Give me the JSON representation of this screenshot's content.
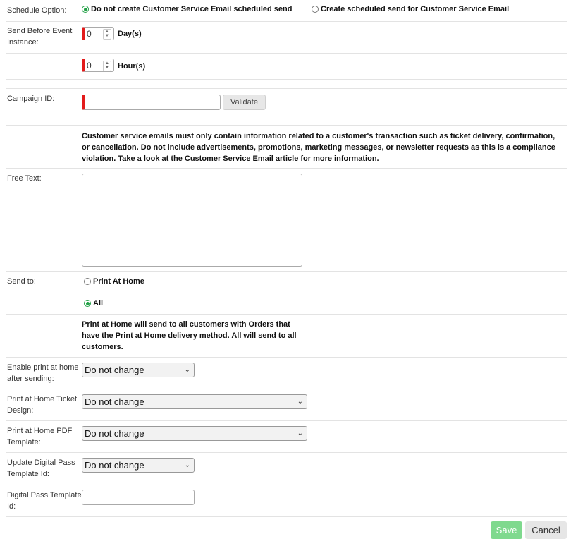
{
  "schedule": {
    "label": "Schedule Option:",
    "option_no": "Do not create Customer Service Email scheduled send",
    "option_yes": "Create scheduled send for Customer Service Email"
  },
  "send_before": {
    "label": "Send Before Event Instance:",
    "days_value": "0",
    "days_unit": "Day(s)",
    "hours_value": "0",
    "hours_unit": "Hour(s)"
  },
  "campaign": {
    "label": "Campaign ID:",
    "value": "",
    "validate_label": "Validate"
  },
  "notice": {
    "text_before": "Customer service emails must only contain information related to a customer's transaction such as ticket delivery, confirmation, or cancellation. Do not include advertisements, promotions, marketing messages, or newsletter requests as this is a compliance violation. Take a look at the ",
    "link_text": "Customer Service Email",
    "text_after": " article for more information."
  },
  "free_text": {
    "label": "Free Text:",
    "value": ""
  },
  "send_to": {
    "label": "Send to:",
    "option_print": "Print At Home",
    "option_all": "All",
    "description": "Print at Home will send to all customers with Orders that have the Print at Home delivery method. All will send to all customers."
  },
  "enable_print": {
    "label": "Enable print at home after sending:",
    "selected": "Do not change"
  },
  "ticket_design": {
    "label": "Print at Home Ticket Design:",
    "selected": "Do not change"
  },
  "pdf_template": {
    "label": "Print at Home PDF Template:",
    "selected": "Do not change"
  },
  "digital_pass": {
    "label": "Update Digital Pass Template Id:",
    "selected": "Do not change"
  },
  "digital_pass_id": {
    "label": "Digital Pass Template Id:",
    "value": ""
  },
  "footer": {
    "save_label": "Save",
    "cancel_label": "Cancel"
  },
  "colors": {
    "accent_green": "#21a045",
    "required_red": "#e31b1b",
    "save_green": "#7fd98e"
  }
}
